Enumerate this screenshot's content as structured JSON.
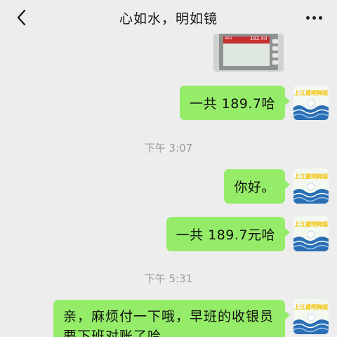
{
  "header": {
    "title": "心如水，明如镜"
  },
  "photo": {
    "sku_text": "sku",
    "amount_text": "192.40"
  },
  "messages": [
    {
      "text": "一共 189.7哈"
    },
    {
      "time": "下午 3:07"
    },
    {
      "text": "你好。"
    },
    {
      "text": "一共 189.7元哈"
    },
    {
      "time": "下午 5:31"
    },
    {
      "text": "亲，麻烦付一下哦，早班的收银员要下班对账了哈。"
    }
  ],
  "avatar": {
    "label": "上江盛明鲜超"
  },
  "colors": {
    "bubble": "#95ec69",
    "background": "#ededed",
    "avatar_wave": "#2a6fb4"
  }
}
